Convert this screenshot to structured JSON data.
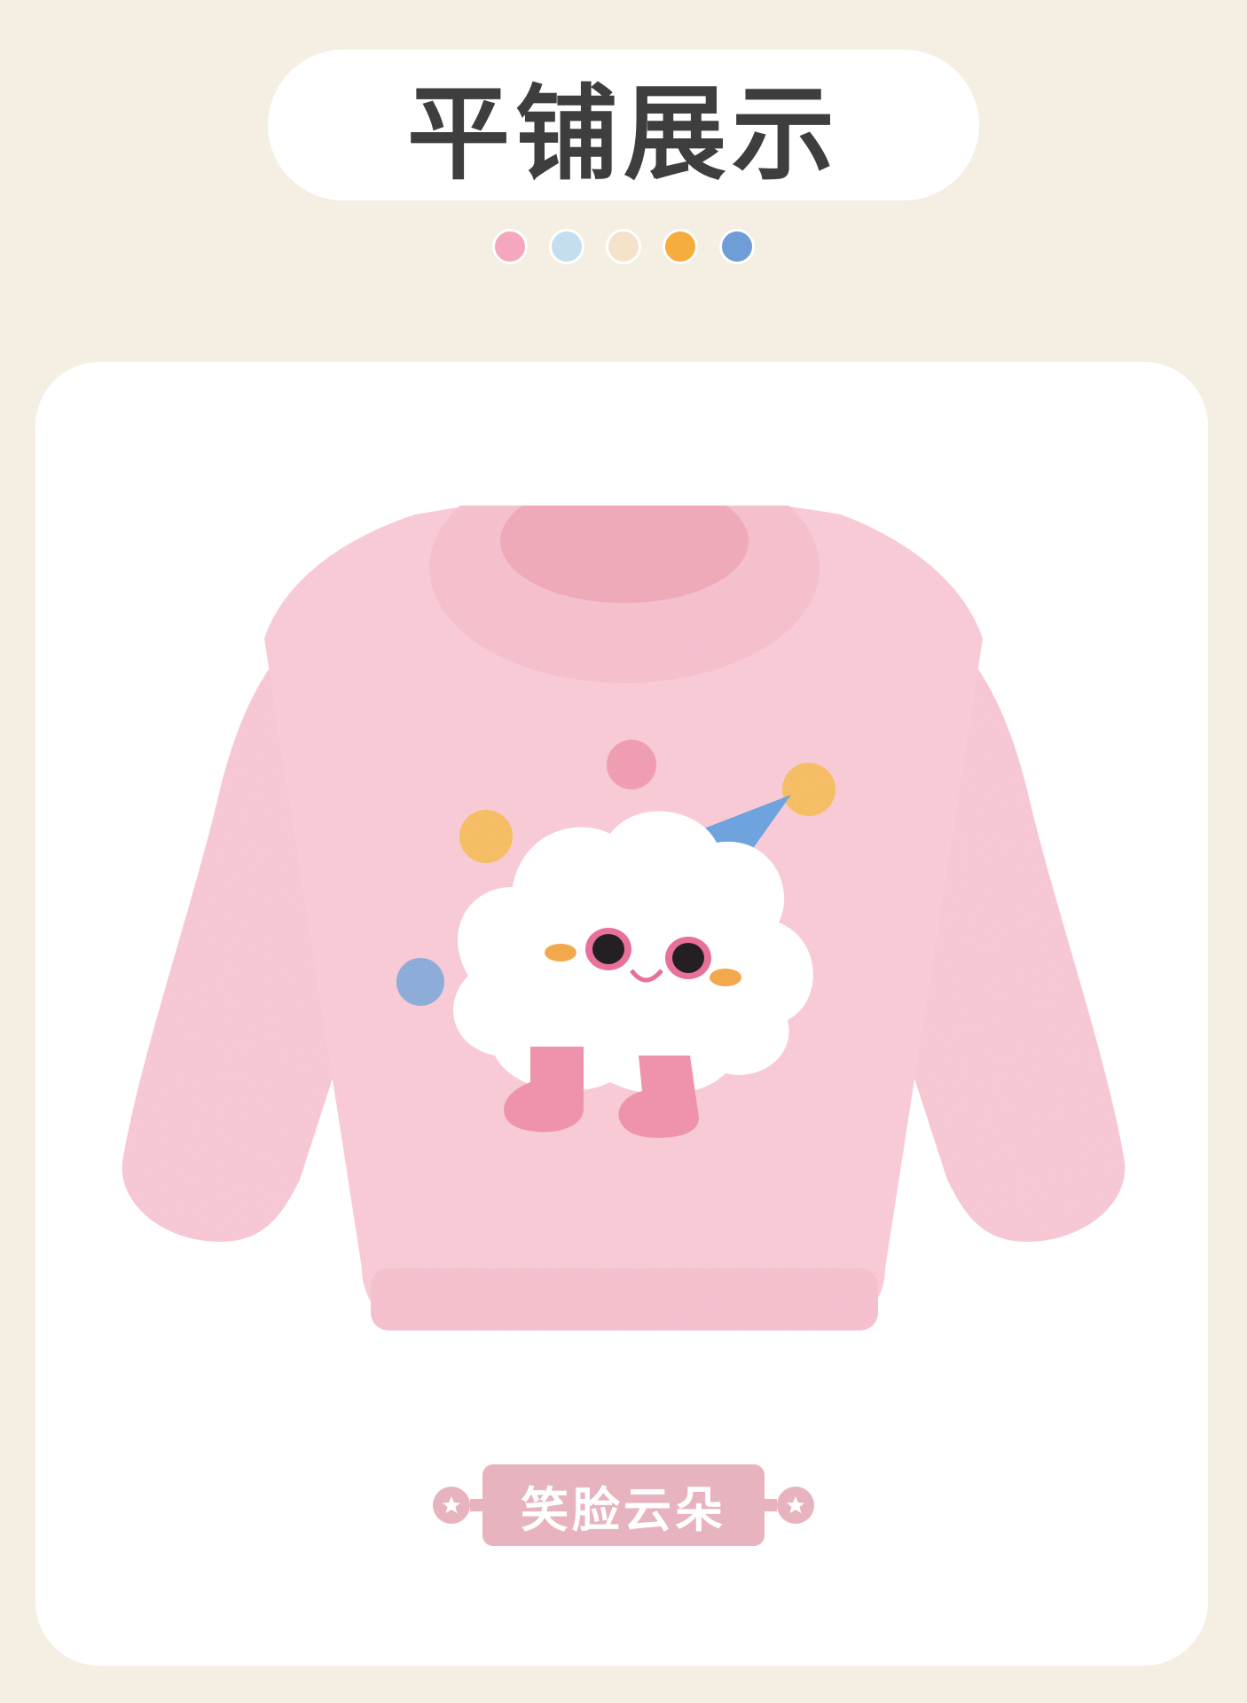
{
  "header": {
    "title": "平铺展示"
  },
  "color_swatches": [
    {
      "name": "pink",
      "color": "#f5a8bd"
    },
    {
      "name": "light-blue",
      "color": "#c4def0"
    },
    {
      "name": "cream",
      "color": "#f3e3c8"
    },
    {
      "name": "orange",
      "color": "#f7ac3e"
    },
    {
      "name": "blue",
      "color": "#6f9dd6"
    }
  ],
  "product": {
    "image_icon": "pink-cloud-sweater"
  },
  "style_label": {
    "text": "笑脸云朵",
    "accent_color": "#e7b3bf"
  }
}
